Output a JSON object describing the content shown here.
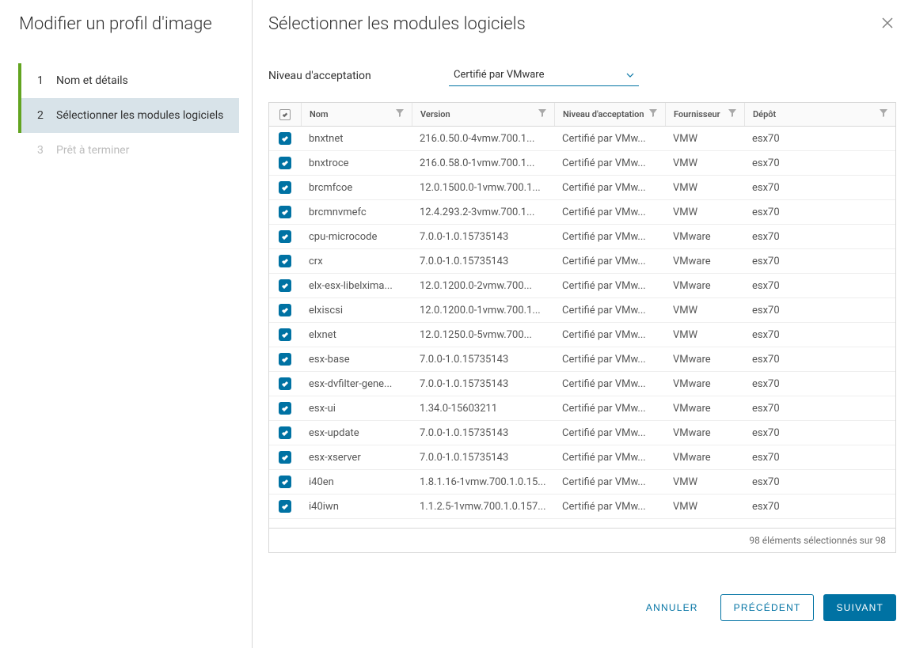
{
  "sidebar": {
    "title": "Modifier un profil d'image",
    "steps": [
      {
        "num": "1",
        "label": "Nom et détails",
        "state": "done"
      },
      {
        "num": "2",
        "label": "Sélectionner les modules logiciels",
        "state": "active"
      },
      {
        "num": "3",
        "label": "Prêt à terminer",
        "state": "disabled"
      }
    ]
  },
  "header": {
    "title": "Sélectionner les modules logiciels"
  },
  "acceptLevel": {
    "label": "Niveau d'acceptation",
    "value": "Certifié par VMware"
  },
  "columns": {
    "name": "Nom",
    "version": "Version",
    "acceptance": "Niveau d'acceptation",
    "supplier": "Fournisseur",
    "depot": "Dépôt"
  },
  "rows": [
    {
      "name": "bnxtnet",
      "version": "216.0.50.0-4vmw.700.1...",
      "acc": "Certifié par VMw...",
      "sup": "VMW",
      "dep": "esx70"
    },
    {
      "name": "bnxtroce",
      "version": "216.0.58.0-1vmw.700.1...",
      "acc": "Certifié par VMw...",
      "sup": "VMW",
      "dep": "esx70"
    },
    {
      "name": "brcmfcoe",
      "version": "12.0.1500.0-1vmw.700.1...",
      "acc": "Certifié par VMw...",
      "sup": "VMW",
      "dep": "esx70"
    },
    {
      "name": "brcmnvmefc",
      "version": "12.4.293.2-3vmw.700.1...",
      "acc": "Certifié par VMw...",
      "sup": "VMW",
      "dep": "esx70"
    },
    {
      "name": "cpu-microcode",
      "version": "7.0.0-1.0.15735143",
      "acc": "Certifié par VMw...",
      "sup": "VMware",
      "dep": "esx70"
    },
    {
      "name": "crx",
      "version": "7.0.0-1.0.15735143",
      "acc": "Certifié par VMw...",
      "sup": "VMware",
      "dep": "esx70"
    },
    {
      "name": "elx-esx-libelxima...",
      "version": "12.0.1200.0-2vmw.700...",
      "acc": "Certifié par VMw...",
      "sup": "VMware",
      "dep": "esx70"
    },
    {
      "name": "elxiscsi",
      "version": "12.0.1200.0-1vmw.700.1...",
      "acc": "Certifié par VMw...",
      "sup": "VMW",
      "dep": "esx70"
    },
    {
      "name": "elxnet",
      "version": "12.0.1250.0-5vmw.700...",
      "acc": "Certifié par VMw...",
      "sup": "VMW",
      "dep": "esx70"
    },
    {
      "name": "esx-base",
      "version": "7.0.0-1.0.15735143",
      "acc": "Certifié par VMw...",
      "sup": "VMware",
      "dep": "esx70"
    },
    {
      "name": "esx-dvfilter-gene...",
      "version": "7.0.0-1.0.15735143",
      "acc": "Certifié par VMw...",
      "sup": "VMware",
      "dep": "esx70"
    },
    {
      "name": "esx-ui",
      "version": "1.34.0-15603211",
      "acc": "Certifié par VMw...",
      "sup": "VMware",
      "dep": "esx70"
    },
    {
      "name": "esx-update",
      "version": "7.0.0-1.0.15735143",
      "acc": "Certifié par VMw...",
      "sup": "VMware",
      "dep": "esx70"
    },
    {
      "name": "esx-xserver",
      "version": "7.0.0-1.0.15735143",
      "acc": "Certifié par VMw...",
      "sup": "VMware",
      "dep": "esx70"
    },
    {
      "name": "i40en",
      "version": "1.8.1.16-1vmw.700.1.0.15...",
      "acc": "Certifié par VMw...",
      "sup": "VMW",
      "dep": "esx70"
    },
    {
      "name": "i40iwn",
      "version": "1.1.2.5-1vmw.700.1.0.157...",
      "acc": "Certifié par VMw...",
      "sup": "VMW",
      "dep": "esx70"
    }
  ],
  "footer": {
    "selection": "98 éléments sélectionnés sur 98"
  },
  "buttons": {
    "cancel": "Annuler",
    "prev": "Précédent",
    "next": "Suivant"
  }
}
